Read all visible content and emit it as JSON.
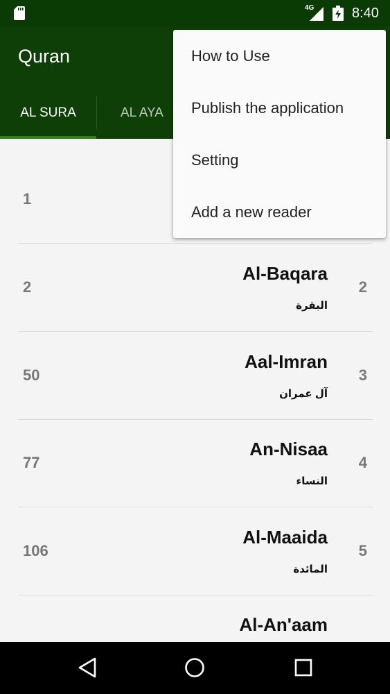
{
  "status_bar": {
    "network": "4G",
    "time": "8:40",
    "icons": [
      "sd-card-icon",
      "signal-icon",
      "battery-charging-icon"
    ]
  },
  "app": {
    "title": "Quran"
  },
  "tabs": [
    {
      "label": "AL SURA",
      "selected": true
    },
    {
      "label": "AL AYA",
      "selected": false
    }
  ],
  "suras": [
    {
      "page": "1",
      "name_en": "",
      "name_ar": "",
      "number": ""
    },
    {
      "page": "2",
      "name_en": "Al-Baqara",
      "name_ar": "البقرة",
      "number": "2"
    },
    {
      "page": "50",
      "name_en": "Aal-Imran",
      "name_ar": "آل عمران",
      "number": "3"
    },
    {
      "page": "77",
      "name_en": "An-Nisaa",
      "name_ar": "النساء",
      "number": "4"
    },
    {
      "page": "106",
      "name_en": "Al-Maaida",
      "name_ar": "المائدة",
      "number": "5"
    },
    {
      "page": "",
      "name_en": "Al-An'aam",
      "name_ar": "",
      "number": ""
    }
  ],
  "menu": {
    "items": [
      {
        "label": "How to Use"
      },
      {
        "label": "Publish the application"
      },
      {
        "label": "Setting"
      },
      {
        "label": "Add a new reader"
      }
    ]
  },
  "nav": {
    "icons": [
      "back-icon",
      "home-icon",
      "recents-icon"
    ]
  },
  "colors": {
    "primary_dark": "#0b3b05",
    "primary": "#0d3f06",
    "accent": "#2e7d1f"
  }
}
